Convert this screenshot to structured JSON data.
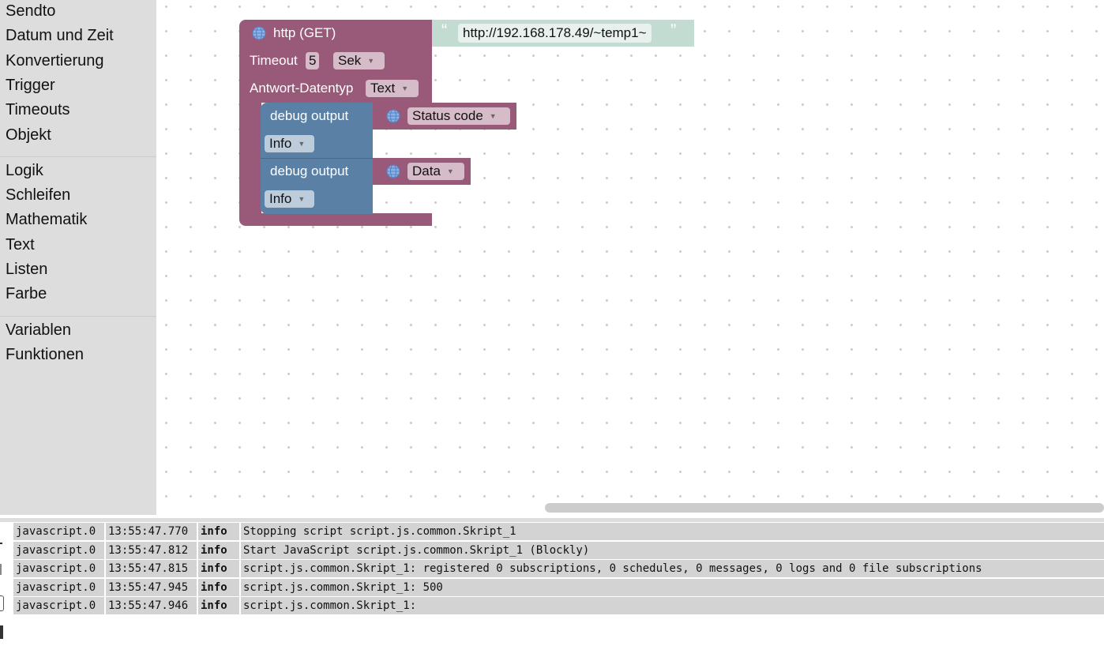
{
  "sidebar": {
    "groups": [
      [
        "Sendto",
        "Datum und Zeit",
        "Konvertierung",
        "Trigger",
        "Timeouts",
        "Objekt"
      ],
      [
        "Logik",
        "Schleifen",
        "Mathematik",
        "Text",
        "Listen",
        "Farbe"
      ],
      [
        "Variablen",
        "Funktionen"
      ]
    ]
  },
  "workspace": {
    "http_block": {
      "title": "http (GET)",
      "icon": "globe-icon",
      "url": "http://192.168.178.49/~temp1~",
      "timeout_label": "Timeout",
      "timeout_value": "5",
      "timeout_unit": "Sek",
      "response_type_label": "Antwort-Datentyp",
      "response_type": "Text",
      "color": "#995a7a"
    },
    "debug_blocks": [
      {
        "label": "debug output",
        "level": "Info",
        "value": "Status code"
      },
      {
        "label": "debug output",
        "level": "Info",
        "value": "Data"
      }
    ],
    "debug_color": "#5b80a5",
    "text_block_color": "#c3dcd2"
  },
  "log": {
    "rows": [
      {
        "source": "javascript.0",
        "time": "13:55:47.770",
        "level": "info",
        "message": "Stopping script script.js.common.Skript_1"
      },
      {
        "source": "javascript.0",
        "time": "13:55:47.812",
        "level": "info",
        "message": "Start JavaScript script.js.common.Skript_1 (Blockly)"
      },
      {
        "source": "javascript.0",
        "time": "13:55:47.815",
        "level": "info",
        "message": "script.js.common.Skript_1: registered 0 subscriptions, 0 schedules, 0 messages, 0 logs and 0 file subscriptions"
      },
      {
        "source": "javascript.0",
        "time": "13:55:47.945",
        "level": "info",
        "message": "script.js.common.Skript_1: 500"
      },
      {
        "source": "javascript.0",
        "time": "13:55:47.946",
        "level": "info",
        "message": "script.js.common.Skript_1:"
      }
    ]
  }
}
